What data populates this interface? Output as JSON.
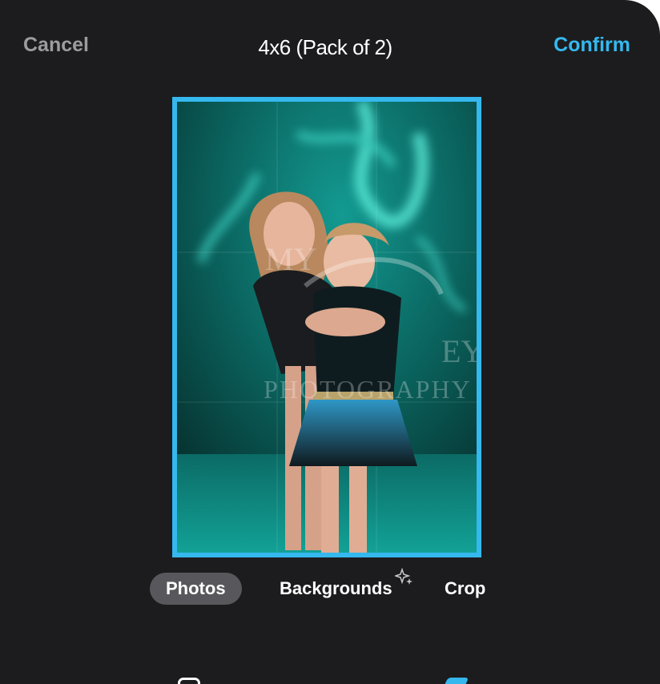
{
  "header": {
    "cancel_label": "Cancel",
    "title": "4x6 (Pack of 2)",
    "confirm_label": "Confirm"
  },
  "editor": {
    "watermark_line1": "MY",
    "watermark_line2": "EY",
    "watermark_line3": "PHOTOGRAPHY"
  },
  "tabs": [
    {
      "label": "Photos",
      "active": true
    },
    {
      "label": "Backgrounds",
      "badge_icon": "sparkle-icon"
    },
    {
      "label": "Crop"
    }
  ],
  "colors": {
    "accent": "#35b8ee",
    "sheet_background": "#1c1c1e",
    "active_tab": "#58585c",
    "cancel_text": "#9c9ca0",
    "photo_teal": "#0d8f87"
  }
}
